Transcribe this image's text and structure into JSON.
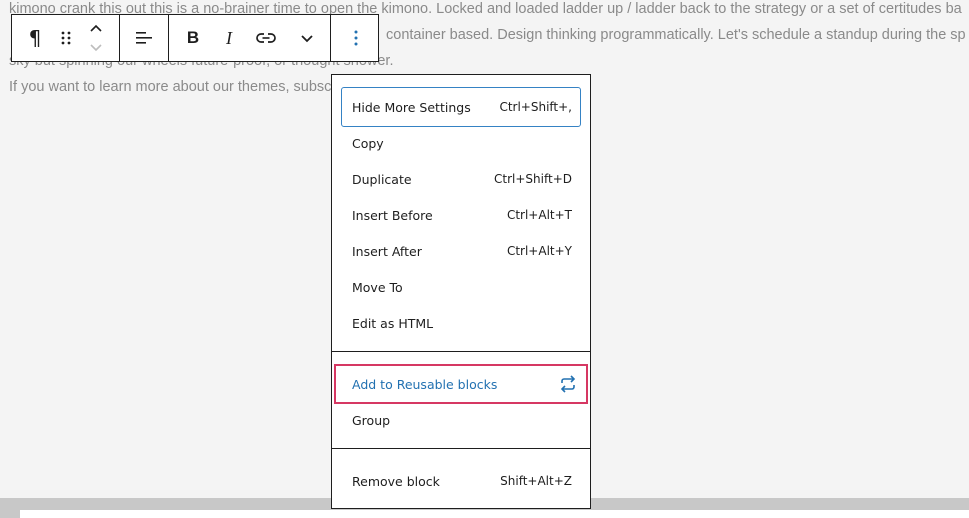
{
  "content": {
    "line1": "kimono crank this out this is a no-brainer time to open the kimono. Locked and loaded ladder up / ladder back to the strategy or a set of certitudes ba",
    "line2": "container based. Design thinking programmatically. Let's schedule a standup during the sp",
    "line3": "sky but spinning our wheels future-proof, or thought shower.",
    "line4": "If you want to learn more about our themes, subsc"
  },
  "toolbar": {
    "icons": [
      "paragraph-icon",
      "drag-handle-icon",
      "move-up-icon",
      "move-down-icon",
      "align-icon",
      "bold-icon",
      "italic-icon",
      "link-icon",
      "more-rich-text-icon",
      "options-icon"
    ],
    "bold_label": "B",
    "italic_label": "I",
    "paragraph_glyph": "¶"
  },
  "menu": {
    "section1": [
      {
        "label": "Hide More Settings",
        "shortcut": "Ctrl+Shift+,"
      },
      {
        "label": "Copy",
        "shortcut": ""
      },
      {
        "label": "Duplicate",
        "shortcut": "Ctrl+Shift+D"
      },
      {
        "label": "Insert Before",
        "shortcut": "Ctrl+Alt+T"
      },
      {
        "label": "Insert After",
        "shortcut": "Ctrl+Alt+Y"
      },
      {
        "label": "Move To",
        "shortcut": ""
      },
      {
        "label": "Edit as HTML",
        "shortcut": ""
      }
    ],
    "section2": [
      {
        "label": "Add to Reusable blocks",
        "icon": "reusable-block-icon"
      },
      {
        "label": "Group"
      }
    ],
    "section3": [
      {
        "label": "Remove block",
        "shortcut": "Shift+Alt+Z"
      }
    ]
  },
  "colors": {
    "accent": "#2271b1",
    "focus_outline": "#3582c4",
    "highlight_outline": "#d63863"
  }
}
